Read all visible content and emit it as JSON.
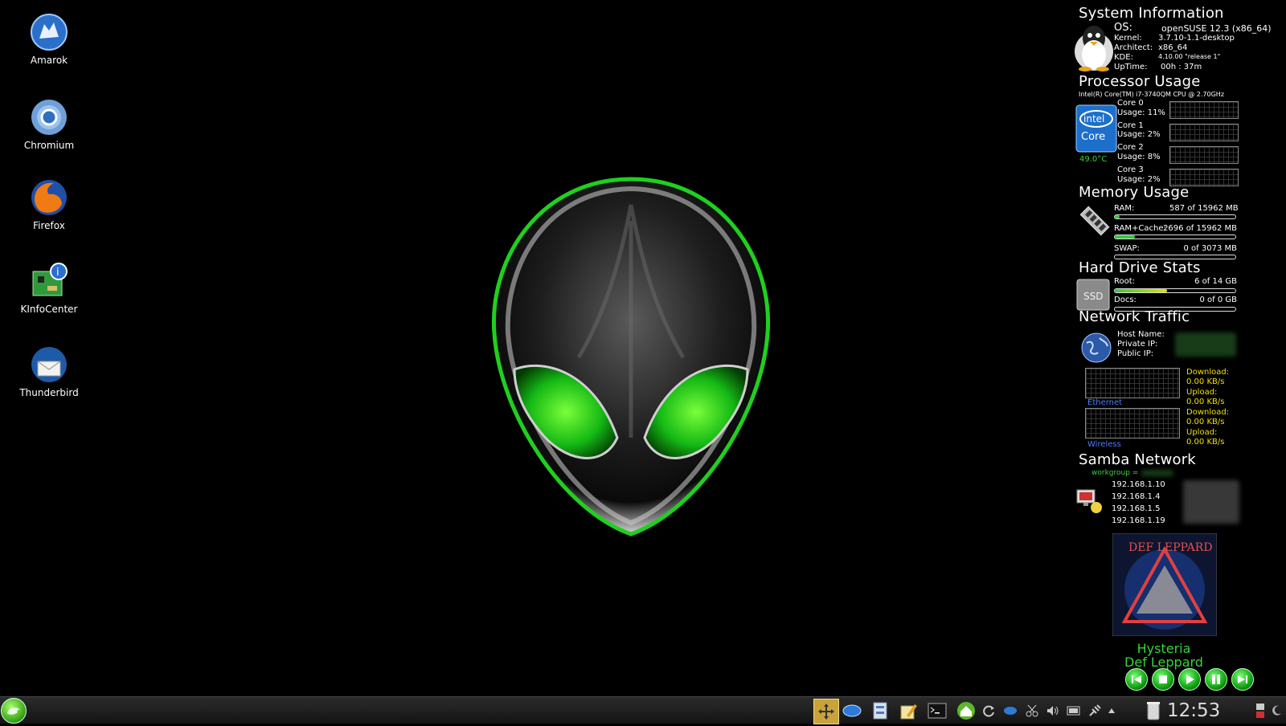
{
  "desktop": {
    "icons": [
      {
        "label": "Amarok",
        "icon": "amarok-wolf-icon"
      },
      {
        "label": "Chromium",
        "icon": "chromium-icon"
      },
      {
        "label": "Firefox",
        "icon": "firefox-icon"
      },
      {
        "label": "KInfoCenter",
        "icon": "kinfocenter-icon"
      },
      {
        "label": "Thunderbird",
        "icon": "thunderbird-icon"
      }
    ],
    "wallpaper": "alien-head-green-eyes",
    "accent": "#37d33b"
  },
  "conky": {
    "system": {
      "title": "System Information",
      "os_label": "OS:",
      "os_value": "openSUSE 12.3 (x86_64)",
      "kernel_label": "Kernel:",
      "kernel_value": "3.7.10-1.1-desktop",
      "arch_label": "Architect:",
      "arch_value": "x86_64",
      "kde_label": "KDE:",
      "kde_value": "4.10.00 \"release 1\"",
      "uptime_label": "UpTime:",
      "uptime_value": "00h : 37m"
    },
    "processor": {
      "title": "Processor Usage",
      "cpu_model": "Intel(R) Core(TM) i7-3740QM CPU @ 2.70GHz",
      "temp": "49.0°C",
      "cores": [
        {
          "name": "Core 0",
          "usage": "Usage: 11%"
        },
        {
          "name": "Core 1",
          "usage": "Usage: 2%"
        },
        {
          "name": "Core 2",
          "usage": "Usage: 8%"
        },
        {
          "name": "Core 3",
          "usage": "Usage: 2%"
        }
      ]
    },
    "memory": {
      "title": "Memory Usage",
      "ram_label": "RAM:",
      "ram_value": "587 of 15962 MB",
      "ram_fraction": 0.037,
      "cache_label": "RAM+Cache:",
      "cache_value": "2696 of 15962 MB",
      "cache_fraction": 0.169,
      "swap_label": "SWAP:",
      "swap_value": "0 of 3073 MB",
      "swap_fraction": 0
    },
    "disk": {
      "title": "Hard Drive Stats",
      "root_label": "Root:",
      "root_value": "6 of 14 GB",
      "root_fraction": 0.43,
      "docs_label": "Docs:",
      "docs_value": "0 of 0 GB",
      "docs_fraction": 0
    },
    "network": {
      "title": "Network Traffic",
      "host_label": "Host Name:",
      "private_label": "Private IP:",
      "public_label": "Public IP:",
      "ethernet_label": "Ethernet",
      "wireless_label": "Wireless",
      "download_label": "Download:",
      "upload_label": "Upload:",
      "eth_down": "0.00 KB/s",
      "eth_up": "0.00 KB/s",
      "wl_down": "0.00 KB/s",
      "wl_up": "0.00 KB/s"
    },
    "samba": {
      "title": "Samba Network",
      "workgroup_label": "workgroup =",
      "hosts": [
        "192.168.1.10",
        "192.168.1.4",
        "192.168.1.5",
        "192.168.1.19"
      ]
    },
    "player": {
      "track": "Hysteria",
      "artist": "Def Leppard",
      "controls": [
        "previous",
        "stop",
        "play",
        "pause",
        "next"
      ]
    }
  },
  "taskbar": {
    "clock": "12:53"
  }
}
